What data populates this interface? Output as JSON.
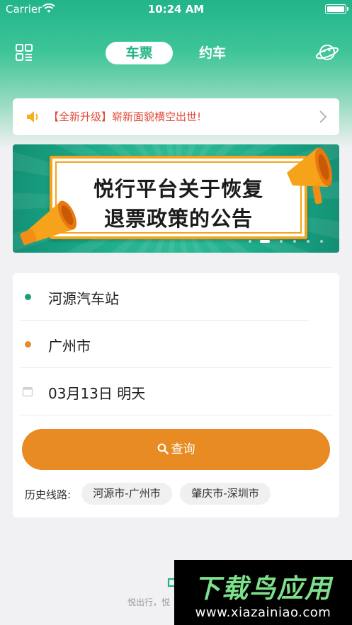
{
  "status_bar": {
    "carrier": "Carrier",
    "time": "10:24 AM"
  },
  "nav": {
    "tabs": [
      {
        "label": "车票",
        "active": true
      },
      {
        "label": "约车",
        "active": false
      }
    ],
    "left_icon": "scan-icon",
    "right_icon": "planet-icon"
  },
  "notice": {
    "text": "【全新升级】崭新面貌横空出世!",
    "color": "#e04a3a"
  },
  "banner": {
    "line1": "悦行平台关于恢复",
    "line2": "退票政策的公告",
    "dot_count": 6,
    "active_dot": 1
  },
  "search": {
    "from": "河源汽车站",
    "to": "广州市",
    "date": "03月13日 明天",
    "query_label": "查询",
    "history_label": "历史线路:",
    "history": [
      "河源市-广州市",
      "肇庆市-深圳市"
    ]
  },
  "footer": {
    "text": "悦出行，悦"
  },
  "watermark": {
    "title": "下载鸟应用",
    "url": "www.xiazainiao.com"
  },
  "colors": {
    "brand_green": "#21b286",
    "accent_orange": "#e88b22",
    "background": "#f1f1f3"
  }
}
